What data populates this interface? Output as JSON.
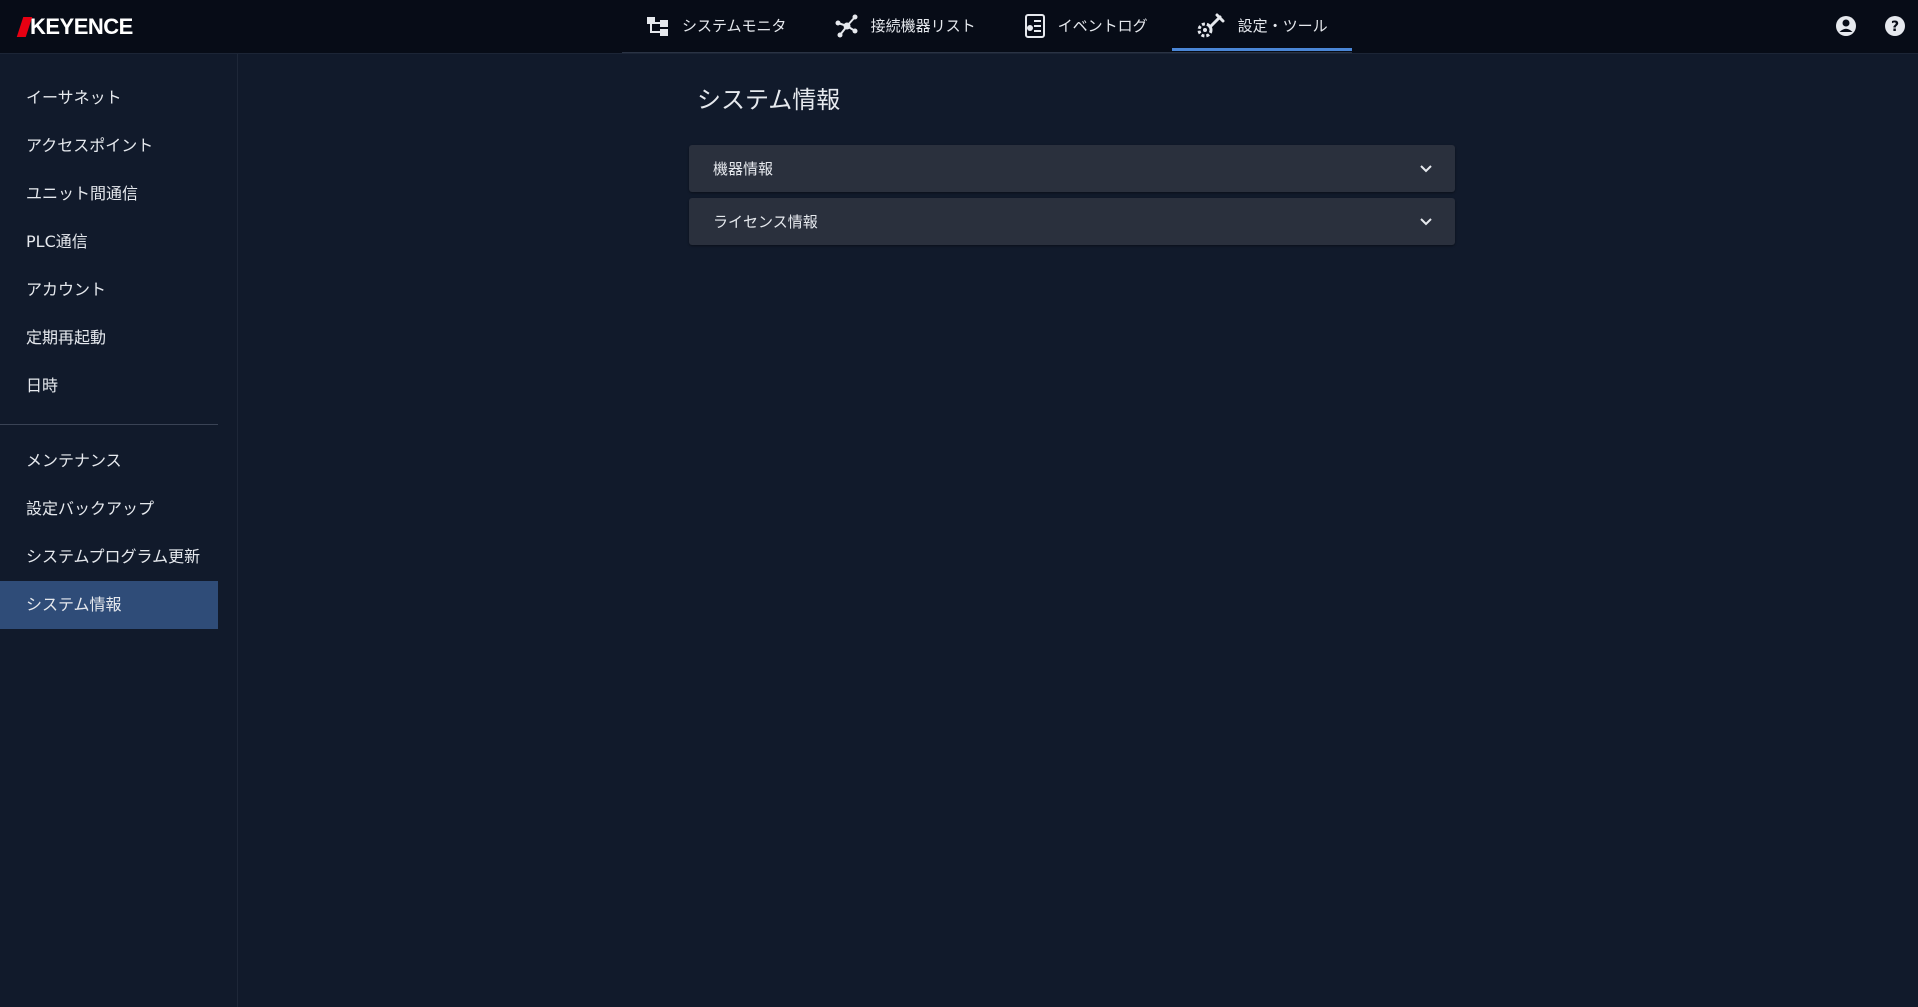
{
  "brand": {
    "logo_text": "KEYENCE"
  },
  "nav": {
    "tabs": [
      {
        "label": "システムモニタ",
        "icon": "system-monitor-icon"
      },
      {
        "label": "接続機器リスト",
        "icon": "network-nodes-icon"
      },
      {
        "label": "イベントログ",
        "icon": "event-log-icon"
      },
      {
        "label": "設定・ツール",
        "icon": "tools-gear-icon",
        "active": true
      }
    ]
  },
  "header_icons": {
    "account": "account-icon",
    "help": "help-icon"
  },
  "sidebar": {
    "group1": [
      {
        "label": "イーサネット"
      },
      {
        "label": "アクセスポイント"
      },
      {
        "label": "ユニット間通信"
      },
      {
        "label": "PLC通信"
      },
      {
        "label": "アカウント"
      },
      {
        "label": "定期再起動"
      },
      {
        "label": "日時"
      }
    ],
    "group2": [
      {
        "label": "メンテナンス"
      },
      {
        "label": "設定バックアップ"
      },
      {
        "label": "システムプログラム更新"
      },
      {
        "label": "システム情報",
        "active": true
      }
    ]
  },
  "main": {
    "title": "システム情報",
    "sections": [
      {
        "label": "機器情報"
      },
      {
        "label": "ライセンス情報"
      }
    ]
  },
  "colors": {
    "background": "#111a2b",
    "topbar": "#070c17",
    "accent": "#4a86d6",
    "sidebar_active": "#2f4c78",
    "panel": "#2a303d",
    "brand_red": "#e60012"
  }
}
